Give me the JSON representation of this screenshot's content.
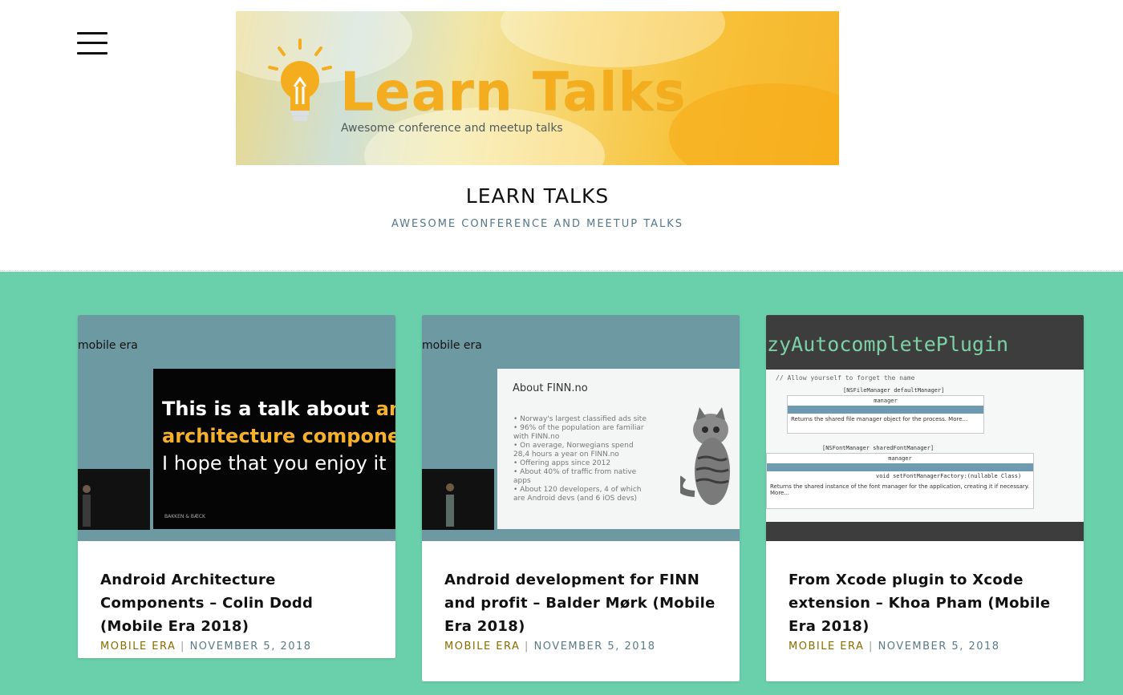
{
  "header": {
    "banner": {
      "logo_text": "Learn Talks",
      "tagline": "Awesome conference and meetup talks"
    },
    "site_title": "LEARN TALKS",
    "site_tagline": "AWESOME CONFERENCE AND MEETUP TALKS",
    "menu_icon": "hamburger-menu-icon"
  },
  "colors": {
    "content_background": "#6ad0ac",
    "category_link": "#8a6d00",
    "date_text": "#5b7b86",
    "banner_accent": "#f4ad1e"
  },
  "posts": [
    {
      "thumbnail": {
        "brand": "mobile era",
        "slide_lines": {
          "line1_white": "This is a talk about ",
          "line1_yellow": "andro",
          "line2": "architecture components",
          "line3": "I hope that you enjoy it"
        },
        "slide_footer": "BAKKEN & BÆCK"
      },
      "title": "Android Architecture Components – Colin Dodd (Mobile Era 2018)",
      "category": "MOBILE ERA",
      "separator": "|",
      "date": "NOVEMBER 5, 2018"
    },
    {
      "thumbnail": {
        "brand": "mobile era",
        "slide_title": "About FINN.no",
        "bullets": [
          "• Norway's largest classified ads site",
          "• 96% of the population are familiar with FINN.no",
          "• On average, Norwegians spend 28,4 hours a year on FINN.no",
          "• Offering apps since 2012",
          "• About 40% of traffic from native apps",
          "• About 120 developers, 4 of which are Android devs (and 6 iOS devs)"
        ]
      },
      "title": "Android development for FINN and profit – Balder Mørk (Mobile Era 2018)",
      "category": "MOBILE ERA",
      "separator": "|",
      "date": "NOVEMBER 5, 2018"
    },
    {
      "thumbnail": {
        "code_title": "zzyAutocompletePlugin",
        "comment": "// Allow yourself to forget the name",
        "line_a": "[NSFileManager defaultManager]",
        "ac1_header": "manager",
        "ac1_desc": "Returns the shared file manager object for the process. More...",
        "line_b": "[NSFontManager sharedFontManager]",
        "ac2_header": "manager",
        "ac2_row": "void setFontManagerFactory:(nullable Class)",
        "ac2_desc": "Returns the shared instance of the font manager for the application, creating it if necessary. More..."
      },
      "title": "From Xcode plugin to Xcode extension – Khoa Pham (Mobile Era 2018)",
      "category": "MOBILE ERA",
      "separator": "|",
      "date": "NOVEMBER 5, 2018"
    }
  ]
}
